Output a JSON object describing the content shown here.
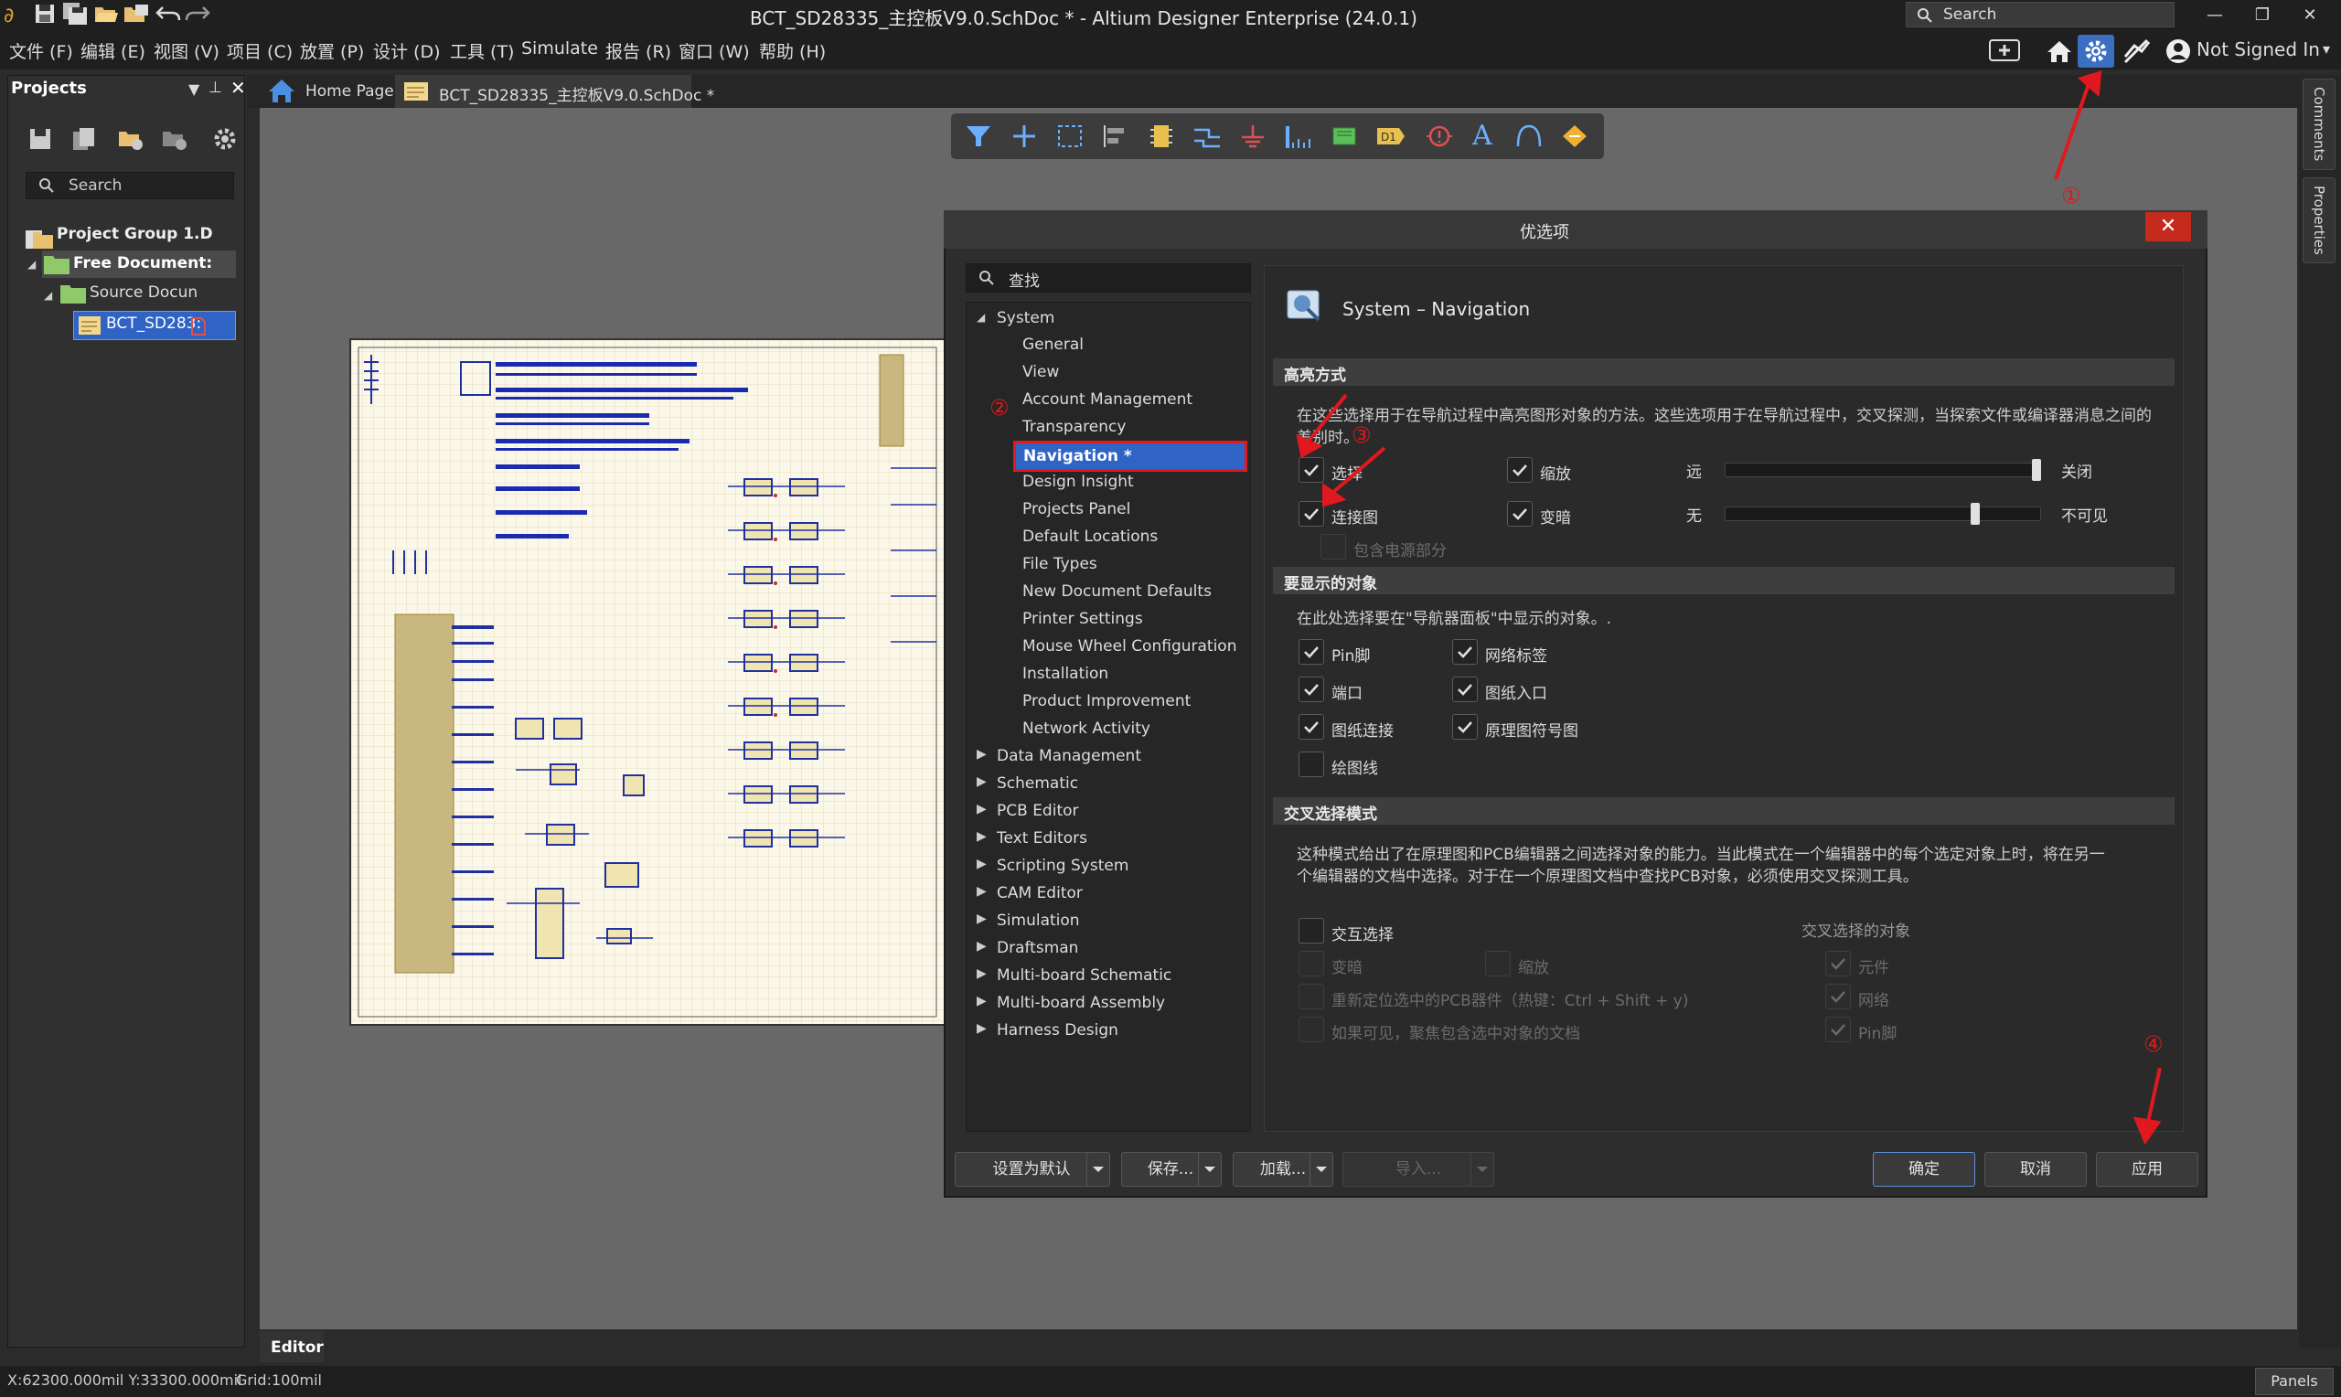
{
  "window": {
    "title": "BCT_SD28335_主控板V9.0.SchDoc * - Altium Designer Enterprise (24.0.1)",
    "search_placeholder": "Search",
    "signin": "Not Signed In"
  },
  "menu": [
    "文件 (F)",
    "编辑 (E)",
    "视图 (V)",
    "项目 (C)",
    "放置 (P)",
    "设计 (D)",
    "工具 (T)",
    "Simulate",
    "报告 (R)",
    "窗口 (W)",
    "帮助 (H)"
  ],
  "projects_panel": {
    "title": "Projects",
    "search_placeholder": "Search",
    "tree": [
      "Project Group 1.D",
      "Free Document:",
      "Source Docun",
      "BCT_SD283:"
    ]
  },
  "tabs": [
    "Home Page",
    "BCT_SD28335_主控板V9.0.SchDoc *"
  ],
  "right_tabs": [
    "Comments",
    "Properties"
  ],
  "editor_tab": "Editor",
  "status": {
    "coords": "X:62300.000mil Y:33300.000mil",
    "grid": "Grid:100mil",
    "panels": "Panels"
  },
  "dialog": {
    "title": "优选项",
    "close": "✕",
    "search_placeholder": "查找",
    "tree_root": "System",
    "system_children": [
      "General",
      "View",
      "Account Management",
      "Transparency",
      "Navigation *",
      "Design Insight",
      "Projects Panel",
      "Default Locations",
      "File Types",
      "New Document Defaults",
      "Printer Settings",
      "Mouse Wheel Configuration",
      "Installation",
      "Product Improvement",
      "Network Activity"
    ],
    "other_nodes": [
      "Data Management",
      "Schematic",
      "PCB Editor",
      "Text Editors",
      "Scripting System",
      "CAM Editor",
      "Simulation",
      "Draftsman",
      "Multi-board Schematic",
      "Multi-board Assembly",
      "Harness Design"
    ],
    "page_title": "System – Navigation",
    "highlight": {
      "header": "高亮方式",
      "desc_line1": "在这些选择用于在导航过程中高亮图形对象的方法。这些选项用于在导航过程中，交叉探测，当探索文件或编译器消息之间的",
      "desc_line2": "差别时。",
      "opt_select": "选择",
      "opt_zoom": "缩放",
      "opt_conngraph": "连接图",
      "opt_dim": "变暗",
      "opt_power": "包含电源部分",
      "far": "远",
      "close_label": "关闭",
      "none": "无",
      "invisible": "不可见",
      "slider1_value": 1.0,
      "slider2_value": 0.8
    },
    "objects": {
      "header": "要显示的对象",
      "desc": "在此处选择要在\"导航器面板\"中显示的对象。.",
      "items": [
        "Pin脚",
        "网络标签",
        "端口",
        "图纸入口",
        "图纸连接",
        "原理图符号图",
        "绘图线"
      ]
    },
    "cross": {
      "header": "交叉选择模式",
      "desc_line1": "这种模式给出了在原理图和PCB编辑器之间选择对象的能力。当此模式在一个编辑器中的每个选定对象上时，将在另一",
      "desc_line2": "个编辑器的文档中选择。对于在一个原理图文档中查找PCB对象，必须使用交叉探测工具。",
      "cross_select": "交互选择",
      "objects_label": "交叉选择的对象",
      "dim": "变暗",
      "zoom": "缩放",
      "reposition": "重新定位选中的PCB器件（热键：Ctrl + Shift + y)",
      "focus": "如果可见，聚焦包含选中对象的文档",
      "obj_component": "元件",
      "obj_net": "网络",
      "obj_pin": "Pin脚"
    },
    "buttons": {
      "default": "设置为默认",
      "save": "保存...",
      "load": "加载...",
      "import": "导入...",
      "ok": "确定",
      "cancel": "取消",
      "apply": "应用"
    }
  },
  "annotations": [
    "①",
    "②",
    "③",
    "④"
  ],
  "colors": {
    "accent": "#2f63c4",
    "annotation_red": "#e0191e",
    "close_red": "#c42b1c"
  }
}
